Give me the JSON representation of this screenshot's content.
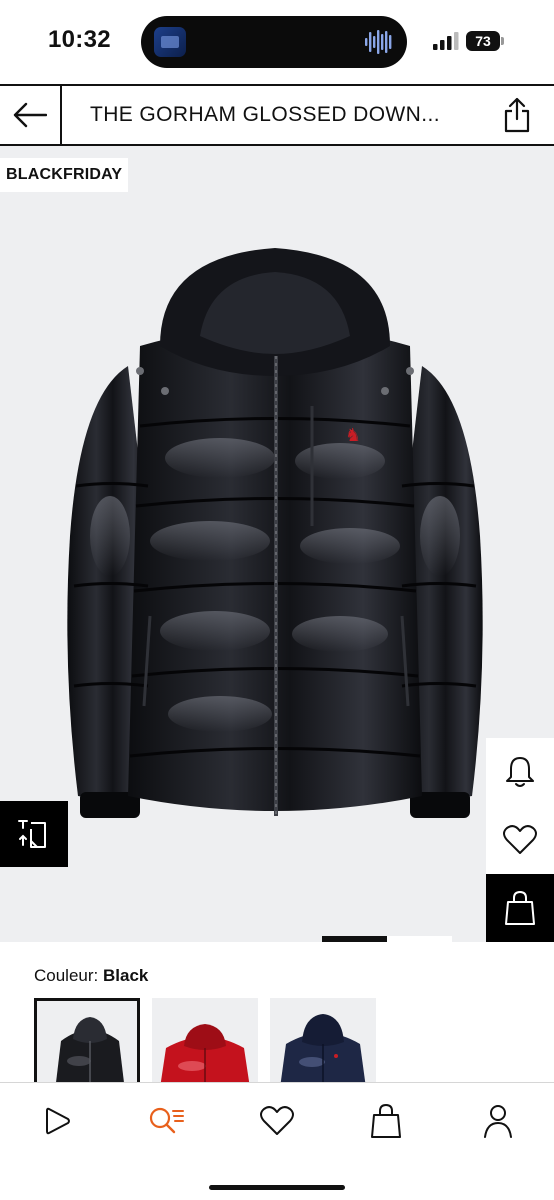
{
  "status_bar": {
    "time": "10:32",
    "battery": "73",
    "icons": [
      "dynamic-island-app-icon",
      "audio-wave-icon",
      "cellular-signal-icon",
      "battery-icon"
    ]
  },
  "header": {
    "title": "THE GORHAM GLOSSED DOWN...",
    "icons": [
      "arrow-left-icon",
      "share-icon"
    ]
  },
  "product": {
    "badge": "BLACKFRIDAY",
    "image_pages": 2,
    "current_page": 1,
    "side_actions": [
      "compare-icon",
      "bell-icon",
      "heart-icon",
      "shopping-bag-icon"
    ]
  },
  "colour": {
    "label": "Couleur:",
    "value": "Black",
    "options": [
      {
        "name": "Black",
        "hex": "#1a1b1f",
        "selected": true
      },
      {
        "name": "Red",
        "hex": "#c4121d",
        "selected": false
      },
      {
        "name": "Navy",
        "hex": "#1e2745",
        "selected": false
      }
    ]
  },
  "bottom_nav": {
    "items": [
      {
        "icon": "play-icon",
        "active": false
      },
      {
        "icon": "search-list-icon",
        "active": true
      },
      {
        "icon": "heart-icon",
        "active": false
      },
      {
        "icon": "shopping-bag-icon",
        "active": false
      },
      {
        "icon": "user-icon",
        "active": false
      }
    ],
    "accent": "#e8601c"
  }
}
